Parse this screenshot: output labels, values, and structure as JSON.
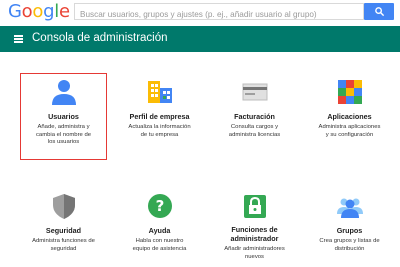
{
  "logo": {
    "letters": [
      "G",
      "o",
      "o",
      "g",
      "l",
      "e"
    ],
    "colors": [
      "#4285f4",
      "#ea4335",
      "#fbbc05",
      "#4285f4",
      "#34a853",
      "#ea4335"
    ]
  },
  "search": {
    "placeholder": "Buscar usuarios, grupos y ajustes (p. ej., añadir usuario al grupo)",
    "button_icon": "search-icon"
  },
  "header": {
    "title": "Consola de administración",
    "menu_icon": "menu-icon",
    "bg_color": "#00796b"
  },
  "tiles": [
    {
      "title": "Usuarios",
      "desc": [
        "Añade, administra y",
        "cambia el nombre de",
        "los usuarios"
      ],
      "icon": "person-icon",
      "selected": true
    },
    {
      "title": "Perfil de empresa",
      "desc": [
        "Actualiza la información",
        "de tu empresa"
      ],
      "icon": "building-icon"
    },
    {
      "title": "Facturación",
      "desc": [
        "Consulta cargos y",
        "administra licencias"
      ],
      "icon": "credit-card-icon"
    },
    {
      "title": "Aplicaciones",
      "desc": [
        "Administra aplicaciones",
        "y su configuración"
      ],
      "icon": "apps-grid-icon"
    },
    {
      "title": "Seguridad",
      "desc": [
        "Administra funciones de",
        "seguridad"
      ],
      "icon": "shield-icon"
    },
    {
      "title": "Ayuda",
      "desc": [
        "Habla con nuestro",
        "equipo de asistencia"
      ],
      "icon": "help-icon"
    },
    {
      "title": "Funciones de administrador",
      "desc": [
        "Añadir administradores",
        "nuevos"
      ],
      "icon": "lock-icon"
    },
    {
      "title": "Grupos",
      "desc": [
        "Crea grupos y listas de",
        "distribución"
      ],
      "icon": "groups-icon"
    }
  ],
  "colors": {
    "accent": "#4285f4",
    "header": "#00796b",
    "selection": "#e53935"
  }
}
